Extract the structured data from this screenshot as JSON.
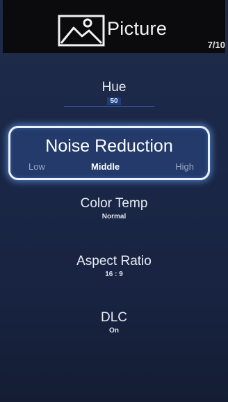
{
  "header": {
    "title": "Picture",
    "page_indicator": "7/10",
    "icon": "picture-icon"
  },
  "menu": {
    "hue": {
      "label": "Hue",
      "value": "50"
    },
    "noise_reduction": {
      "label": "Noise Reduction",
      "options": [
        "Low",
        "Middle",
        "High"
      ],
      "selected": "Middle"
    },
    "color_temp": {
      "label": "Color Temp",
      "value": "Normal"
    },
    "aspect_ratio": {
      "label": "Aspect Ratio",
      "value": "16 : 9"
    },
    "dlc": {
      "label": "DLC",
      "value": "On"
    }
  },
  "colors": {
    "background": "#1a2747",
    "header_bg": "#0b0b0d",
    "highlight_border": "#eaf2ff",
    "glow": "#6eaaff"
  }
}
